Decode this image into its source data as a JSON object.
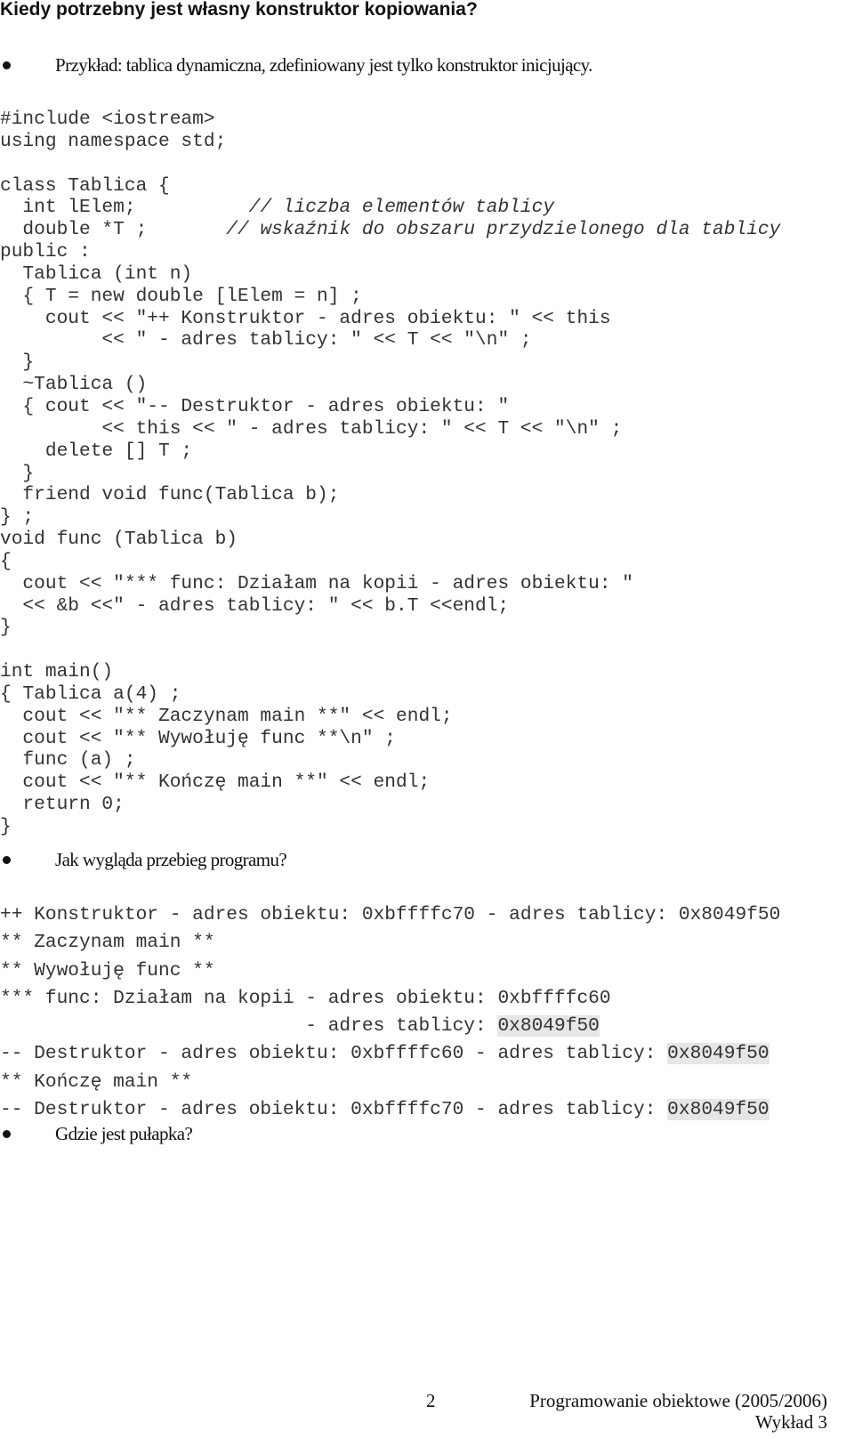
{
  "title": "Kiedy potrzebny jest własny konstruktor kopiowania?",
  "bullets": {
    "example": "Przykład: tablica dynamiczna, zdefiniowany jest tylko konstruktor inicjujący.",
    "question": "Jak wygląda przebieg programu?",
    "trap": "Gdzie jest pułapka?"
  },
  "code": [
    {
      "text": "#include <iostream>"
    },
    {
      "text": "using namespace std;"
    },
    {
      "text": ""
    },
    {
      "text": "class Tablica {"
    },
    {
      "text": "  int lElem;          ",
      "comment": "// liczba elementów tablicy"
    },
    {
      "text": "  double *T ;       ",
      "comment": "// wskaźnik do obszaru przydzielonego dla tablicy"
    },
    {
      "text": "public :"
    },
    {
      "text": "  Tablica (int n)"
    },
    {
      "text": "  { T = new double [lElem = n] ;"
    },
    {
      "text": "    cout << \"++ Konstruktor - adres obiektu: \" << this"
    },
    {
      "text": "         << \" - adres tablicy: \" << T << \"\\n\" ;"
    },
    {
      "text": "  }"
    },
    {
      "text": "  ~Tablica ()"
    },
    {
      "text": "  { cout << \"-- Destruktor - adres obiektu: \""
    },
    {
      "text": "         << this << \" - adres tablicy: \" << T << \"\\n\" ;"
    },
    {
      "text": "    delete [] T ;"
    },
    {
      "text": "  }"
    },
    {
      "text": "  friend void func(Tablica b);"
    },
    {
      "text": "} ;"
    },
    {
      "text": "void func (Tablica b)"
    },
    {
      "text": "{"
    },
    {
      "text": "  cout << \"*** func: Działam na kopii - adres obiektu: \""
    },
    {
      "text": "  << &b <<\" - adres tablicy: \" << b.T <<endl;"
    },
    {
      "text": "}"
    },
    {
      "text": ""
    },
    {
      "text": "int main()"
    },
    {
      "text": "{ Tablica a(4) ;"
    },
    {
      "text": "  cout << \"** Zaczynam main **\" << endl;"
    },
    {
      "text": "  cout << \"** Wywołuję func **\\n\" ;"
    },
    {
      "text": "  func (a) ;"
    },
    {
      "text": "  cout << \"** Kończę main **\" << endl;"
    },
    {
      "text": "  return 0;"
    },
    {
      "text": "}"
    }
  ],
  "output": [
    {
      "text": "++ Konstruktor - adres obiektu: 0xbffffc70 - adres tablicy: ",
      "addr": "0x8049f50",
      "highlight": false
    },
    {
      "text": "** Zaczynam main **",
      "addr": "",
      "highlight": false
    },
    {
      "text": "** Wywołuję func **",
      "addr": "",
      "highlight": false
    },
    {
      "text": "*** func: Działam na kopii - adres obiektu: 0xbffffc60",
      "addr": "",
      "highlight": false
    },
    {
      "text": "                           - adres tablicy: ",
      "addr": "0x8049f50",
      "highlight": true
    },
    {
      "text": "-- Destruktor - adres obiektu: 0xbffffc60 - adres tablicy: ",
      "addr": "0x8049f50",
      "highlight": true
    },
    {
      "text": "** Kończę main **",
      "addr": "",
      "highlight": false
    },
    {
      "text": "-- Destruktor - adres obiektu: 0xbffffc70 - adres tablicy: ",
      "addr": "0x8049f50",
      "highlight": true
    }
  ],
  "footer": {
    "page_number": "2",
    "course": "Programowanie obiektowe (2005/2006)",
    "lecture": "Wykład 3"
  }
}
